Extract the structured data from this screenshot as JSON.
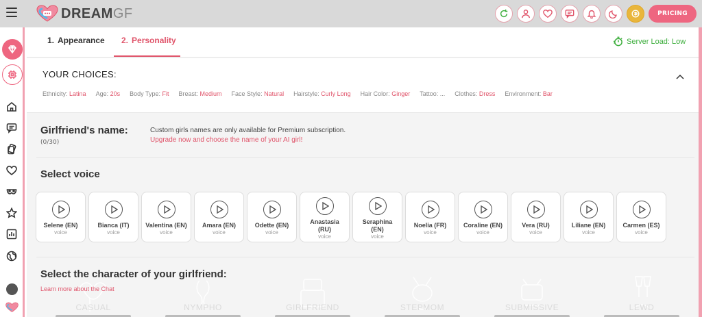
{
  "app": {
    "brand_main": "DREAM",
    "brand_sub": "GF"
  },
  "header": {
    "pricing_label": "PRICING"
  },
  "tabs": [
    {
      "num": "1.",
      "label": "Appearance"
    },
    {
      "num": "2.",
      "label": "Personality"
    }
  ],
  "server_load": "Server Load: Low",
  "choices": {
    "title": "YOUR CHOICES:",
    "items": [
      {
        "label": "Ethnicity:",
        "value": "Latina"
      },
      {
        "label": "Age:",
        "value": "20s"
      },
      {
        "label": "Body Type:",
        "value": "Fit"
      },
      {
        "label": "Breast:",
        "value": "Medium"
      },
      {
        "label": "Face Style:",
        "value": "Natural"
      },
      {
        "label": "Hairstyle:",
        "value": "Curly Long"
      },
      {
        "label": "Hair Color:",
        "value": "Ginger"
      },
      {
        "label": "Tattoo:",
        "value": "..."
      },
      {
        "label": "Clothes:",
        "value": "Dress"
      },
      {
        "label": "Environment:",
        "value": "Bar"
      }
    ]
  },
  "name_section": {
    "title": "Girlfriend's name:",
    "count": "(0/30)",
    "note": "Custom girls names are only available for Premium subscription.",
    "link": "Upgrade now and choose the name of your AI girl!"
  },
  "voice_section": {
    "title": "Select voice",
    "voices": [
      {
        "name": "Selene (EN)",
        "sub": "voice"
      },
      {
        "name": "Bianca (IT)",
        "sub": "voice"
      },
      {
        "name": "Valentina (EN)",
        "sub": "voice"
      },
      {
        "name": "Amara (EN)",
        "sub": "voice"
      },
      {
        "name": "Odette (EN)",
        "sub": "voice"
      },
      {
        "name": "Anastasia (RU)",
        "sub": "voice"
      },
      {
        "name": "Seraphina (EN)",
        "sub": "voice"
      },
      {
        "name": "Noelia (FR)",
        "sub": "voice"
      },
      {
        "name": "Coraline (EN)",
        "sub": "voice"
      },
      {
        "name": "Vera (RU)",
        "sub": "voice"
      },
      {
        "name": "Liliane (EN)",
        "sub": "voice"
      },
      {
        "name": "Carmen (ES)",
        "sub": "voice"
      }
    ]
  },
  "character_section": {
    "title": "Select the character of your girlfriend:",
    "link": "Learn more about the Chat",
    "cards": [
      {
        "label": "CASUAL"
      },
      {
        "label": "NYMPHO"
      },
      {
        "label": "GIRLFRIEND"
      },
      {
        "label": "STEPMOM"
      },
      {
        "label": "SUBMISSIVE"
      },
      {
        "label": "LEWD"
      }
    ]
  },
  "colors": {
    "accent": "#e0546a",
    "pricing": "#ee6680",
    "server_ok": "#3cae3c",
    "gold": "#e9b63c"
  }
}
